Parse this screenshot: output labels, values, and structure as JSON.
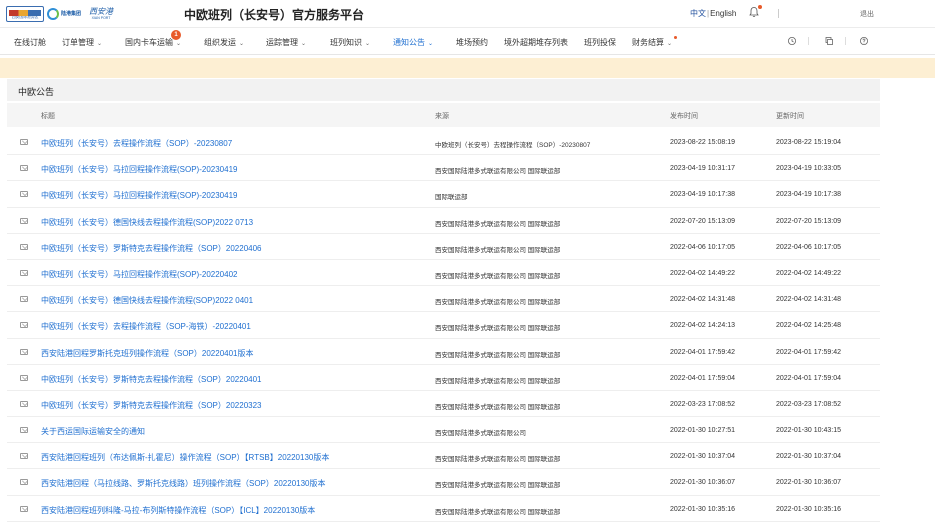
{
  "header": {
    "logo_a_text": "西安国际港务区",
    "logo_b_text": "陆港集团",
    "logo_c_text": "西安港",
    "logo_c_sub": "XIAN PORT",
    "site_title": "中欧班列（长安号）官方服务平台",
    "lang_cn": "中文",
    "lang_en": "English",
    "logout": "退出"
  },
  "nav": {
    "items": [
      {
        "label": "在线订舱",
        "has_chevron": false
      },
      {
        "label": "订单管理",
        "has_chevron": true
      },
      {
        "label": "国内卡车运输",
        "has_chevron": true
      },
      {
        "label": "组织发运",
        "has_chevron": true
      },
      {
        "label": "运踪管理",
        "has_chevron": true
      },
      {
        "label": "班列知识",
        "has_chevron": true
      },
      {
        "label": "通知公告",
        "has_chevron": true,
        "active": true
      },
      {
        "label": "堆场预约",
        "has_chevron": false
      },
      {
        "label": "境外超期堆存列表",
        "has_chevron": false
      },
      {
        "label": "班列投保",
        "has_chevron": false
      },
      {
        "label": "财务结算",
        "has_chevron": true
      }
    ],
    "badge_count": "1",
    "colors": {
      "active": "#1f6fd0",
      "badge": "#e85a2a"
    }
  },
  "panel": {
    "title": "中欧公告",
    "columns": {
      "title": "标题",
      "source": "来源",
      "published": "发布时间",
      "updated": "更新时间"
    }
  },
  "rows": [
    {
      "title": "中欧班列（长安号）去程操作流程（SOP）-20230807",
      "source": "中欧班列（长安号）去程操作流程（SOP）-20230807",
      "published": "2023-08-22 15:08:19",
      "updated": "2023-08-22 15:19:04"
    },
    {
      "title": "中欧班列（长安号）马拉回程操作流程(SOP)-20230419",
      "source": "西安国际陆港多式联运有限公司 国际联运部",
      "published": "2023-04-19 10:31:17",
      "updated": "2023-04-19 10:33:05"
    },
    {
      "title": "中欧班列（长安号）马拉回程操作流程(SOP)-20230419",
      "source": "国际联运部",
      "published": "2023-04-19 10:17:38",
      "updated": "2023-04-19 10:17:38"
    },
    {
      "title": "中欧班列（长安号）德国快线去程操作流程(SOP)2022 0713",
      "source": "西安国际陆港多式联运有限公司 国际联运部",
      "published": "2022-07-20 15:13:09",
      "updated": "2022-07-20 15:13:09"
    },
    {
      "title": "中欧班列（长安号）罗斯特克去程操作流程（SOP）20220406",
      "source": "西安国际陆港多式联运有限公司 国际联运部",
      "published": "2022-04-06 10:17:05",
      "updated": "2022-04-06 10:17:05"
    },
    {
      "title": "中欧班列（长安号）马拉回程操作流程(SOP)-20220402",
      "source": "西安国际陆港多式联运有限公司 国际联运部",
      "published": "2022-04-02 14:49:22",
      "updated": "2022-04-02 14:49:22"
    },
    {
      "title": "中欧班列（长安号）德国快线去程操作流程(SOP)2022 0401",
      "source": "西安国际陆港多式联运有限公司 国际联运部",
      "published": "2022-04-02 14:31:48",
      "updated": "2022-04-02 14:31:48"
    },
    {
      "title": "中欧班列（长安号）去程操作流程（SOP-海铁）-20220401",
      "source": "西安国际陆港多式联运有限公司 国际联运部",
      "published": "2022-04-02 14:24:13",
      "updated": "2022-04-02 14:25:48"
    },
    {
      "title": "西安陆港回程罗斯托克班列操作流程（SOP）20220401版本",
      "source": "西安国际陆港多式联运有限公司 国际联运部",
      "published": "2022-04-01 17:59:42",
      "updated": "2022-04-01 17:59:42"
    },
    {
      "title": "中欧班列（长安号）罗斯特克去程操作流程（SOP）20220401",
      "source": "西安国际陆港多式联运有限公司 国际联运部",
      "published": "2022-04-01 17:59:04",
      "updated": "2022-04-01 17:59:04"
    },
    {
      "title": "中欧班列（长安号）罗斯特克去程操作流程（SOP）20220323",
      "source": "西安国际陆港多式联运有限公司 国际联运部",
      "published": "2022-03-23 17:08:52",
      "updated": "2022-03-23 17:08:52"
    },
    {
      "title": "关于西运国际运输安全的通知",
      "source": "西安国际陆港多式联运有限公司",
      "published": "2022-01-30 10:27:51",
      "updated": "2022-01-30 10:43:15"
    },
    {
      "title": "西安陆港回程班列（布达佩斯-扎霍尼）操作流程（SOP）【RTSB】20220130版本",
      "source": "西安国际陆港多式联运有限公司 国际联运部",
      "published": "2022-01-30 10:37:04",
      "updated": "2022-01-30 10:37:04"
    },
    {
      "title": "西安陆港回程（马拉线路、罗斯托克线路）班列操作流程（SOP）20220130版本",
      "source": "西安国际陆港多式联运有限公司 国际联运部",
      "published": "2022-01-30 10:36:07",
      "updated": "2022-01-30 10:36:07"
    },
    {
      "title": "西安陆港回程班列科隆-马拉-布列斯特操作流程（SOP）【ICL】20220130版本",
      "source": "西安国际陆港多式联运有限公司 国际联运部",
      "published": "2022-01-30 10:35:16",
      "updated": "2022-01-30 10:35:16"
    }
  ]
}
